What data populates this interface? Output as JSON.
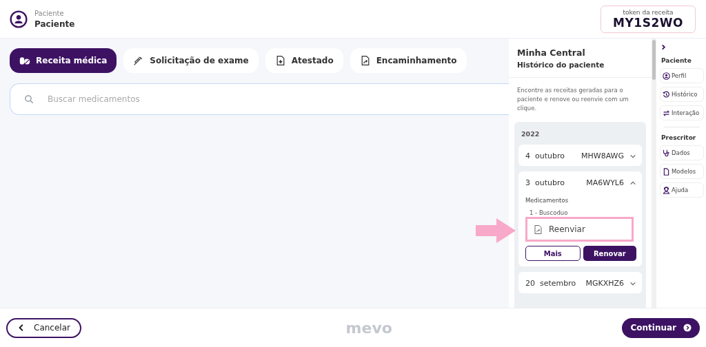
{
  "header": {
    "caption": "Paciente",
    "title": "Paciente",
    "token_label": "token da receita",
    "token": "MY1S2WO"
  },
  "tabs": [
    {
      "label": "Receita médica",
      "selected": true
    },
    {
      "label": "Solicitação de exame",
      "selected": false
    },
    {
      "label": "Atestado",
      "selected": false
    },
    {
      "label": "Encaminhamento",
      "selected": false
    }
  ],
  "search": {
    "placeholder": "Buscar medicamentos"
  },
  "history": {
    "title": "Minha Central",
    "subtitle": "Histórico do paciente",
    "description": "Encontre as receitas geradas para o paciente e renove ou reenvie com um clique.",
    "year": "2022",
    "entries": [
      {
        "day": "4",
        "month": "outubro",
        "code": "MHW8AWG",
        "expanded": false
      },
      {
        "day": "3",
        "month": "outubro",
        "code": "MA6WYL6",
        "expanded": true,
        "section": "Medicamentos",
        "items": [
          "1 - Buscoduo"
        ],
        "resend": "Reenviar",
        "more": "Mais",
        "renew": "Renovar"
      },
      {
        "day": "20",
        "month": "setembro",
        "code": "MGKXHZ6",
        "expanded": false
      }
    ]
  },
  "side_nav": {
    "groups": [
      {
        "title": "Paciente",
        "items": [
          {
            "label": "Perfil"
          },
          {
            "label": "Histórico"
          },
          {
            "label": "Interação"
          }
        ]
      },
      {
        "title": "Prescritor",
        "items": [
          {
            "label": "Dados"
          },
          {
            "label": "Modelos"
          },
          {
            "label": "Ajuda"
          }
        ]
      }
    ]
  },
  "footer": {
    "cancel": "Cancelar",
    "logo": "mevo",
    "continue": "Continuar"
  }
}
